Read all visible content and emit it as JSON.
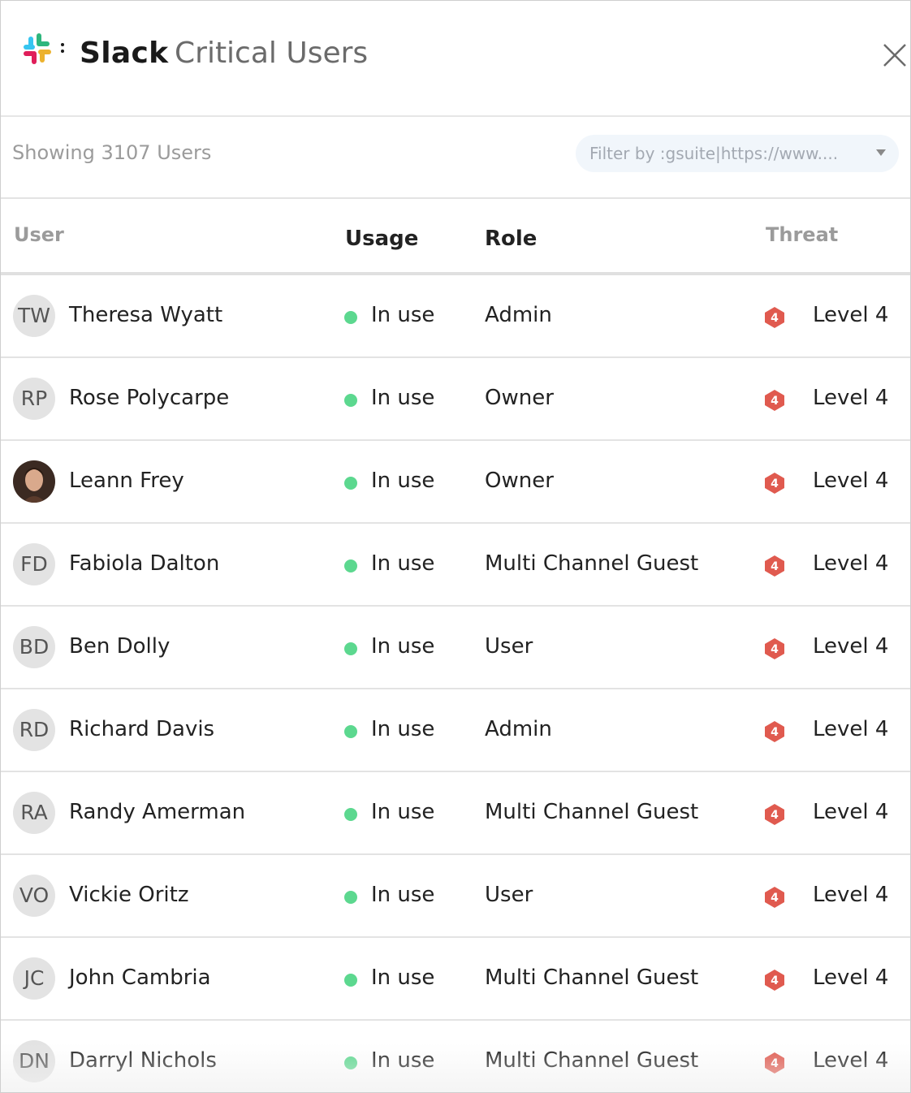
{
  "header": {
    "brand": "Slack",
    "title": "Critical Users",
    "logo_icon": "slack-logo-icon",
    "close_icon": "close-icon"
  },
  "toolbar": {
    "showing_text": "Showing 3107 Users",
    "filter_text": "Filter by :gsuite|https://www....",
    "filter_caret_icon": "caret-down-icon"
  },
  "table": {
    "columns": [
      "User",
      "Usage",
      "Role",
      "Threat"
    ],
    "status_color": "#5cd88f",
    "threat_color": "#e05a4f",
    "rows": [
      {
        "initials": "TW",
        "name": "Theresa Wyatt",
        "usage": "In use",
        "role": "Admin",
        "threat_badge": "4",
        "threat": "Level 4"
      },
      {
        "initials": "RP",
        "name": "Rose Polycarpe",
        "usage": "In use",
        "role": "Owner",
        "threat_badge": "4",
        "threat": "Level 4"
      },
      {
        "initials": "",
        "photo": true,
        "name": "Leann Frey",
        "usage": "In use",
        "role": "Owner",
        "threat_badge": "4",
        "threat": "Level 4"
      },
      {
        "initials": "FD",
        "name": "Fabiola Dalton",
        "usage": "In use",
        "role": "Multi Channel Guest",
        "threat_badge": "4",
        "threat": "Level 4"
      },
      {
        "initials": "BD",
        "name": "Ben Dolly",
        "usage": "In use",
        "role": "User",
        "threat_badge": "4",
        "threat": "Level 4"
      },
      {
        "initials": "RD",
        "name": "Richard Davis",
        "usage": "In use",
        "role": "Admin",
        "threat_badge": "4",
        "threat": "Level 4"
      },
      {
        "initials": "RA",
        "name": "Randy Amerman",
        "usage": "In use",
        "role": "Multi Channel Guest",
        "threat_badge": "4",
        "threat": "Level 4"
      },
      {
        "initials": "VO",
        "name": "Vickie Oritz",
        "usage": "In use",
        "role": "User",
        "threat_badge": "4",
        "threat": "Level 4"
      },
      {
        "initials": "JC",
        "name": "John Cambria",
        "usage": "In use",
        "role": "Multi Channel Guest",
        "threat_badge": "4",
        "threat": "Level 4"
      },
      {
        "initials": "DN",
        "name": "Darryl Nichols",
        "usage": "In use",
        "role": "Multi Channel Guest",
        "threat_badge": "4",
        "threat": "Level 4"
      }
    ]
  }
}
